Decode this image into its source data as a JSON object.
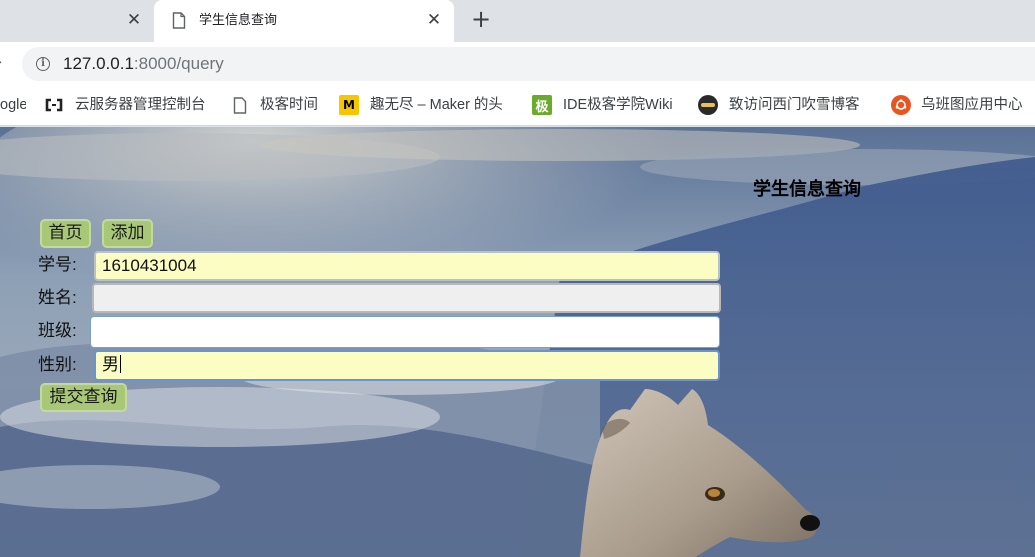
{
  "browser": {
    "tabs": [
      {
        "title": "",
        "active": false
      },
      {
        "title": "学生信息查询",
        "active": true
      }
    ],
    "url_host": "127.0.0.1",
    "url_rest": ":8000/query",
    "bookmarks": [
      {
        "label": "ogle",
        "icon": ""
      },
      {
        "label": "云服务器管理控制台",
        "icon": "aliyun-icon"
      },
      {
        "label": "极客时间",
        "icon": "page-icon"
      },
      {
        "label": "趣无尽 – Maker 的头",
        "icon": "maker-icon",
        "icon_text": "M"
      },
      {
        "label": "IDE极客学院Wiki",
        "icon": "jike-icon",
        "icon_text": "极"
      },
      {
        "label": "致访问西门吹雪博客",
        "icon": "blog-icon"
      },
      {
        "label": "乌班图应用中心",
        "icon": "ubuntu-icon"
      }
    ]
  },
  "page": {
    "title": "学生信息查询",
    "nav": {
      "home": "首页",
      "add": "添加"
    },
    "form": {
      "student_id_label": "学号:",
      "student_id_value": "1610431004",
      "name_label": "姓名:",
      "name_value": "",
      "class_label": "班级:",
      "class_value": "",
      "gender_label": "性别:",
      "gender_value": "男",
      "submit": "提交查询"
    }
  },
  "colors": {
    "button_bg": "#a8c878",
    "autofill_bg": "#fbfdc3",
    "title": "#000000"
  }
}
